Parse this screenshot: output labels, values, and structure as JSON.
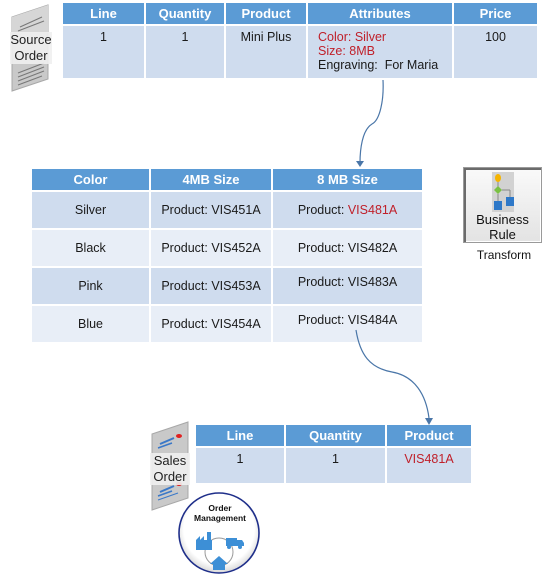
{
  "source_order": {
    "label_line1": "Source",
    "label_line2": "Order",
    "headers": [
      "Line",
      "Quantity",
      "Product",
      "Attributes",
      "Price"
    ],
    "row": {
      "line": "1",
      "quantity": "1",
      "product": "Mini Plus",
      "attributes": {
        "color": "Color: Silver",
        "size": "Size: 8MB",
        "engraving": "Engraving:  For Maria"
      },
      "price": "100"
    }
  },
  "transform_table": {
    "headers": [
      "Color",
      "4MB Size",
      "8 MB Size"
    ],
    "rows": [
      {
        "color": "Silver",
        "size4": "Product: VIS451A",
        "size8_prefix": "Product: ",
        "size8_code": "VIS481A",
        "highlight": true
      },
      {
        "color": "Black",
        "size4": "Product: VIS452A",
        "size8_prefix": "Product: ",
        "size8_code": "VIS482A",
        "highlight": false
      },
      {
        "color": "Pink",
        "size4": "Product: VIS453A",
        "size8_prefix": "Product: ",
        "size8_code": "VIS483A",
        "highlight": false
      },
      {
        "color": "Blue",
        "size4": "Product: VIS454A",
        "size8_prefix": "Product: ",
        "size8_code": "VIS484A",
        "highlight": false
      }
    ]
  },
  "business_rule": {
    "label_line1": "Business",
    "label_line2": "Rule",
    "caption": "Transform"
  },
  "sales_order": {
    "label_line1": "Sales",
    "label_line2": "Order",
    "headers": [
      "Line",
      "Quantity",
      "Product"
    ],
    "row": {
      "line": "1",
      "quantity": "1",
      "product": "VIS481A"
    }
  },
  "order_management": {
    "title_line1": "Order",
    "title_line2": "Management"
  },
  "colors": {
    "header_blue": "#5b9bd5",
    "row_dark": "#cfdcee",
    "row_light": "#e8eef7",
    "highlight_red": "#c0202a",
    "arrow": "#4a76a8"
  }
}
